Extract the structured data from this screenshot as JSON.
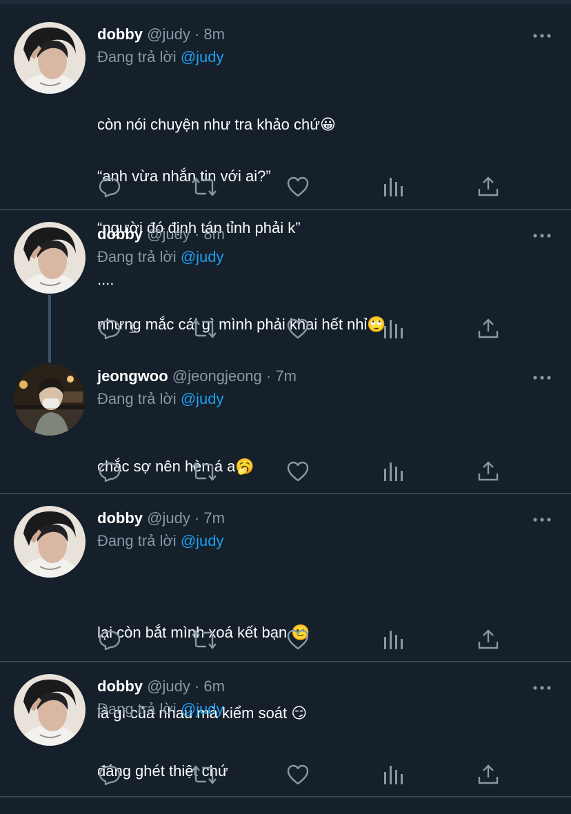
{
  "common": {
    "replying_label": "Đang trả lời",
    "reply_mention": "@judy",
    "separator": "·"
  },
  "tweets": [
    {
      "name": "dobby",
      "handle": "@judy",
      "time": "8m",
      "lines": [
        "còn nói chuyện như tra khảo chứ😀",
        "“anh vừa nhắn tin với ai?”",
        "“người đó định tán tỉnh phải k”",
        "...."
      ],
      "reply_count": ""
    },
    {
      "name": "dobby",
      "handle": "@judy",
      "time": "8m",
      "lines": [
        "nhưng mắc cái gì mình phải khai hết nhỉ🙄"
      ],
      "reply_count": "1"
    },
    {
      "name": "jeongwoo",
      "handle": "@jeongjeong",
      "time": "7m",
      "lines": [
        "chắc sợ nên hèn á a🥱"
      ],
      "reply_count": ""
    },
    {
      "name": "dobby",
      "handle": "@judy",
      "time": "7m",
      "lines": [
        "lại còn bắt mình xoá kết bạn 🙂",
        "là gì của nhau mà kiểm soát 😏"
      ],
      "reply_count": ""
    },
    {
      "name": "dobby",
      "handle": "@judy",
      "time": "6m",
      "lines": [
        "đáng ghét thiệt chứ"
      ],
      "reply_count": ""
    }
  ],
  "icons": {
    "reply": "reply-icon",
    "retweet": "retweet-icon",
    "like": "heart-icon",
    "analytics": "analytics-icon",
    "share": "share-icon",
    "more": "more-icon"
  },
  "colors": {
    "background": "#15202b",
    "muted": "#8899a6",
    "accent": "#1da1f2",
    "divider": "#38444d"
  }
}
